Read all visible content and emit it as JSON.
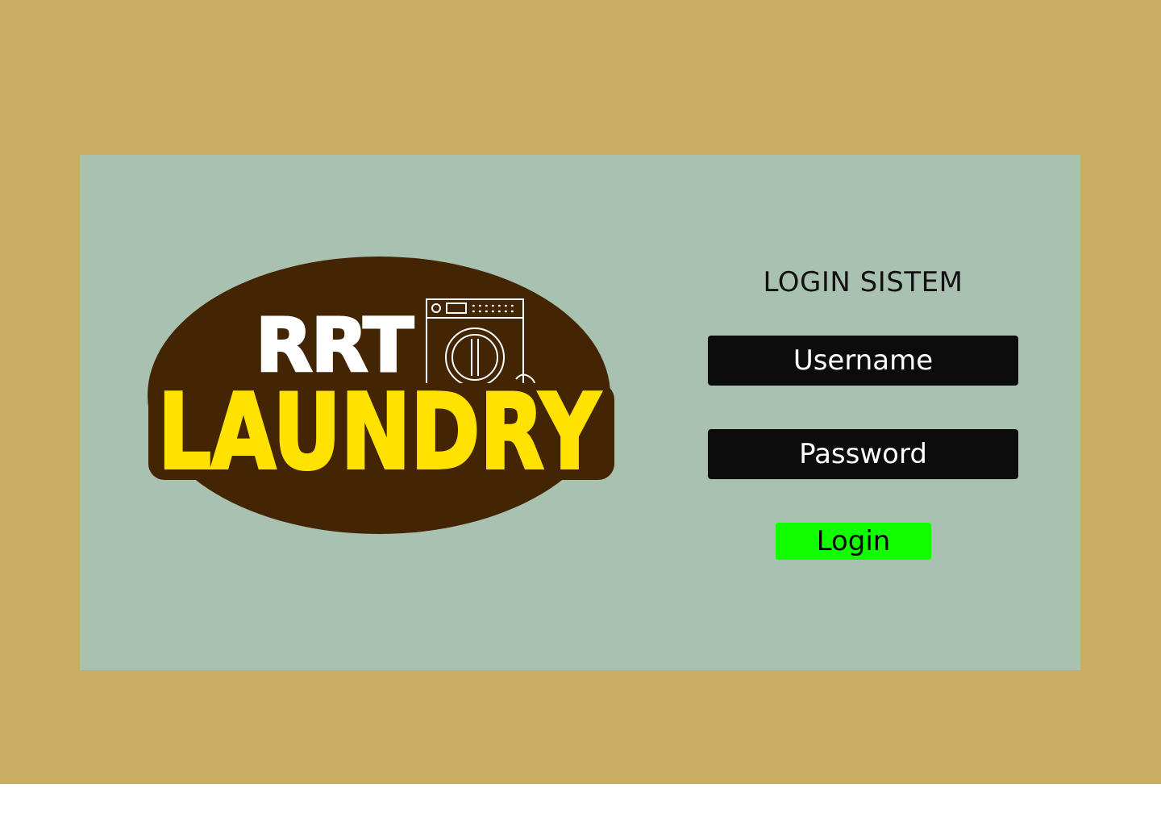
{
  "logo": {
    "line1": "RRT",
    "line2": "LAUNDRY",
    "icon": "washing-machine-icon",
    "colors": {
      "badge": "#432403",
      "line1": "#ffffff",
      "line2": "#ffe200"
    }
  },
  "login": {
    "title": "LOGIN SISTEM",
    "username_placeholder": "Username",
    "password_placeholder": "Password",
    "button_label": "Login"
  },
  "colors": {
    "page_background": "#caad62",
    "card_background": "#a9c1b1",
    "field_background": "#0b0c0b",
    "button_background": "#12ff00"
  }
}
